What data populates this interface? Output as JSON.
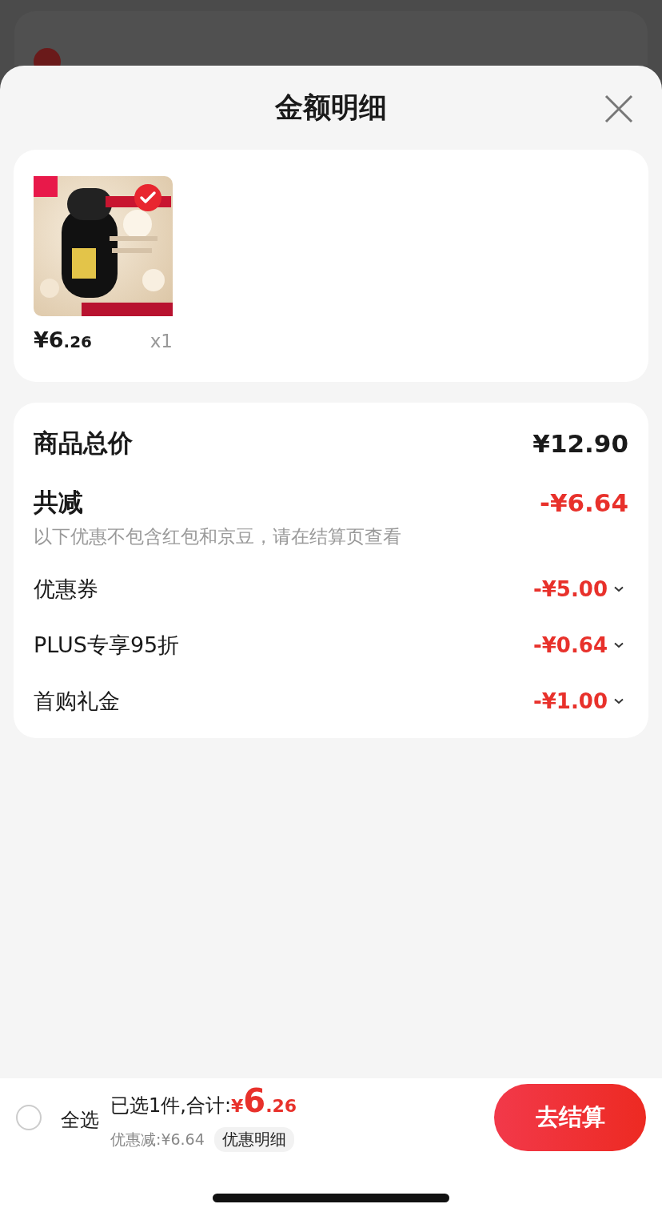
{
  "sheet": {
    "title": "金额明细"
  },
  "products": [
    {
      "kind": "picture",
      "checked": true,
      "price_main": "¥6",
      "price_decimal": ".26",
      "quantity": "x1"
    }
  ],
  "summary": {
    "total_label": "商品总价",
    "total_value": "¥12.90",
    "discount_label": "共减",
    "discount_value": "-¥6.64",
    "note": "以下优惠不包含红包和京豆，请在结算页查看"
  },
  "discounts": [
    {
      "label": "优惠券",
      "value": "-¥5.00",
      "expanded": false
    },
    {
      "label": "PLUS专享95折",
      "value": "-¥0.64",
      "expanded": false
    },
    {
      "label": "首购礼金",
      "value": "-¥1.00",
      "expanded": false
    }
  ],
  "bottom_bar": {
    "select_all_checked": false,
    "select_all_label": "全选",
    "selected_text": "已选1件,合计:",
    "currency": "¥",
    "total_main": "6",
    "total_decimal": ".26",
    "discount_text": "优惠减:¥6.64",
    "details_button": "优惠明细",
    "checkout_button": "去结算"
  }
}
